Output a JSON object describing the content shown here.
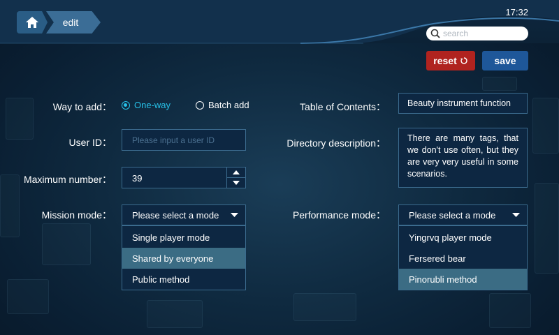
{
  "header": {
    "breadcrumb_current": "edit",
    "time": "17:32"
  },
  "search": {
    "placeholder": "search"
  },
  "toolbar": {
    "reset_label": "reset",
    "save_label": "save"
  },
  "form": {
    "way_to_add": {
      "label": "Way to add：",
      "options": [
        "One-way",
        "Batch add"
      ],
      "selected": "One-way"
    },
    "user_id": {
      "label": "User ID：",
      "placeholder": "Please input a user ID"
    },
    "maximum_number": {
      "label": "Maximum number：",
      "value": "39"
    },
    "mission_mode": {
      "label": "Mission mode：",
      "placeholder": "Please select a mode",
      "options": [
        "Single player mode",
        "Shared by everyone",
        "Public method"
      ],
      "highlighted": "Shared by everyone"
    },
    "table_of_contents": {
      "label": "Table of Contents：",
      "value": "Beauty instrument function"
    },
    "directory_description": {
      "label": "Directory description：",
      "value": "There are many tags, that we don't use often, but they are very very useful in some scenarios."
    },
    "performance_mode": {
      "label": "Performance mode：",
      "placeholder": "Please select a mode",
      "options": [
        "Yingrvq player mode",
        "Fersered bear",
        "Pinorubli method"
      ],
      "highlighted": "Pinorubli method"
    }
  },
  "colors": {
    "accent": "#27c1e8",
    "reset_button": "#b0231f",
    "save_button": "#1e5799",
    "field_border": "#3b6b8e",
    "highlight_row": "#3b6c84"
  },
  "icons": [
    "home-icon",
    "search-icon",
    "refresh-icon",
    "chevron-up-icon",
    "chevron-down-icon",
    "caret-down-icon"
  ]
}
